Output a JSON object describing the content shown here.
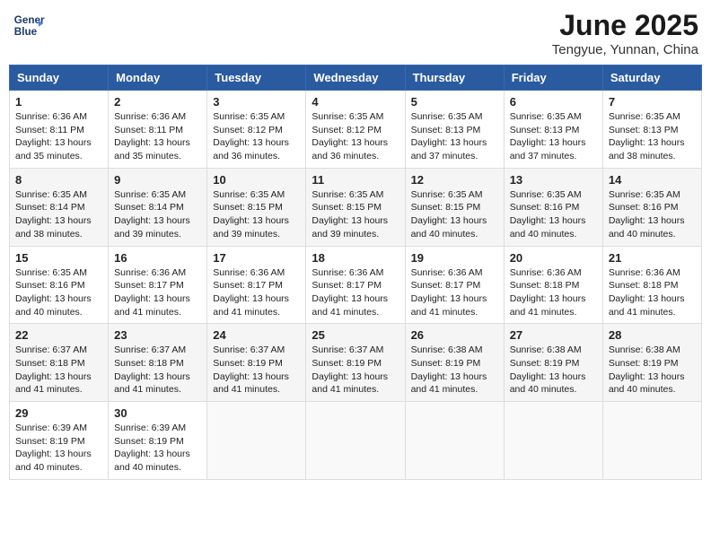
{
  "header": {
    "logo_line1": "General",
    "logo_line2": "Blue",
    "month_title": "June 2025",
    "location": "Tengyue, Yunnan, China"
  },
  "weekdays": [
    "Sunday",
    "Monday",
    "Tuesday",
    "Wednesday",
    "Thursday",
    "Friday",
    "Saturday"
  ],
  "weeks": [
    [
      {
        "day": "1",
        "sunrise": "6:36 AM",
        "sunset": "8:11 PM",
        "daylight": "13 hours and 35 minutes."
      },
      {
        "day": "2",
        "sunrise": "6:36 AM",
        "sunset": "8:11 PM",
        "daylight": "13 hours and 35 minutes."
      },
      {
        "day": "3",
        "sunrise": "6:35 AM",
        "sunset": "8:12 PM",
        "daylight": "13 hours and 36 minutes."
      },
      {
        "day": "4",
        "sunrise": "6:35 AM",
        "sunset": "8:12 PM",
        "daylight": "13 hours and 36 minutes."
      },
      {
        "day": "5",
        "sunrise": "6:35 AM",
        "sunset": "8:13 PM",
        "daylight": "13 hours and 37 minutes."
      },
      {
        "day": "6",
        "sunrise": "6:35 AM",
        "sunset": "8:13 PM",
        "daylight": "13 hours and 37 minutes."
      },
      {
        "day": "7",
        "sunrise": "6:35 AM",
        "sunset": "8:13 PM",
        "daylight": "13 hours and 38 minutes."
      }
    ],
    [
      {
        "day": "8",
        "sunrise": "6:35 AM",
        "sunset": "8:14 PM",
        "daylight": "13 hours and 38 minutes."
      },
      {
        "day": "9",
        "sunrise": "6:35 AM",
        "sunset": "8:14 PM",
        "daylight": "13 hours and 39 minutes."
      },
      {
        "day": "10",
        "sunrise": "6:35 AM",
        "sunset": "8:15 PM",
        "daylight": "13 hours and 39 minutes."
      },
      {
        "day": "11",
        "sunrise": "6:35 AM",
        "sunset": "8:15 PM",
        "daylight": "13 hours and 39 minutes."
      },
      {
        "day": "12",
        "sunrise": "6:35 AM",
        "sunset": "8:15 PM",
        "daylight": "13 hours and 40 minutes."
      },
      {
        "day": "13",
        "sunrise": "6:35 AM",
        "sunset": "8:16 PM",
        "daylight": "13 hours and 40 minutes."
      },
      {
        "day": "14",
        "sunrise": "6:35 AM",
        "sunset": "8:16 PM",
        "daylight": "13 hours and 40 minutes."
      }
    ],
    [
      {
        "day": "15",
        "sunrise": "6:35 AM",
        "sunset": "8:16 PM",
        "daylight": "13 hours and 40 minutes."
      },
      {
        "day": "16",
        "sunrise": "6:36 AM",
        "sunset": "8:17 PM",
        "daylight": "13 hours and 41 minutes."
      },
      {
        "day": "17",
        "sunrise": "6:36 AM",
        "sunset": "8:17 PM",
        "daylight": "13 hours and 41 minutes."
      },
      {
        "day": "18",
        "sunrise": "6:36 AM",
        "sunset": "8:17 PM",
        "daylight": "13 hours and 41 minutes."
      },
      {
        "day": "19",
        "sunrise": "6:36 AM",
        "sunset": "8:17 PM",
        "daylight": "13 hours and 41 minutes."
      },
      {
        "day": "20",
        "sunrise": "6:36 AM",
        "sunset": "8:18 PM",
        "daylight": "13 hours and 41 minutes."
      },
      {
        "day": "21",
        "sunrise": "6:36 AM",
        "sunset": "8:18 PM",
        "daylight": "13 hours and 41 minutes."
      }
    ],
    [
      {
        "day": "22",
        "sunrise": "6:37 AM",
        "sunset": "8:18 PM",
        "daylight": "13 hours and 41 minutes."
      },
      {
        "day": "23",
        "sunrise": "6:37 AM",
        "sunset": "8:18 PM",
        "daylight": "13 hours and 41 minutes."
      },
      {
        "day": "24",
        "sunrise": "6:37 AM",
        "sunset": "8:19 PM",
        "daylight": "13 hours and 41 minutes."
      },
      {
        "day": "25",
        "sunrise": "6:37 AM",
        "sunset": "8:19 PM",
        "daylight": "13 hours and 41 minutes."
      },
      {
        "day": "26",
        "sunrise": "6:38 AM",
        "sunset": "8:19 PM",
        "daylight": "13 hours and 41 minutes."
      },
      {
        "day": "27",
        "sunrise": "6:38 AM",
        "sunset": "8:19 PM",
        "daylight": "13 hours and 40 minutes."
      },
      {
        "day": "28",
        "sunrise": "6:38 AM",
        "sunset": "8:19 PM",
        "daylight": "13 hours and 40 minutes."
      }
    ],
    [
      {
        "day": "29",
        "sunrise": "6:39 AM",
        "sunset": "8:19 PM",
        "daylight": "13 hours and 40 minutes."
      },
      {
        "day": "30",
        "sunrise": "6:39 AM",
        "sunset": "8:19 PM",
        "daylight": "13 hours and 40 minutes."
      },
      null,
      null,
      null,
      null,
      null
    ]
  ]
}
